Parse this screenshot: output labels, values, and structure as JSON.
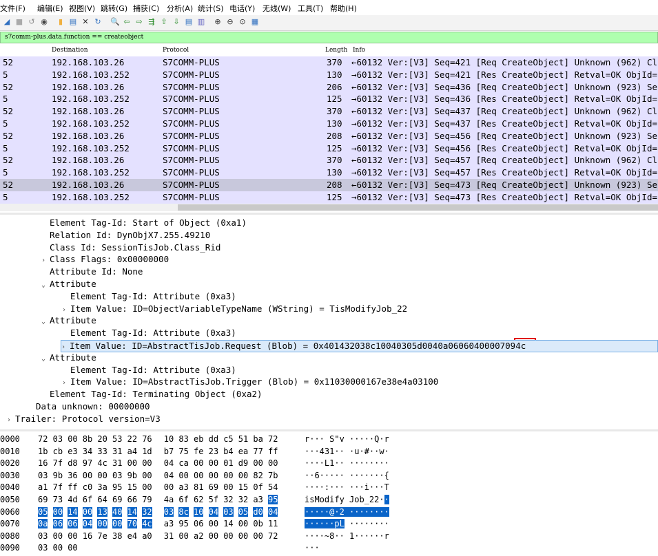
{
  "menu": [
    "文件(F)",
    "编辑(E)",
    "视图(V)",
    "跳转(G)",
    "捕获(C)",
    "分析(A)",
    "统计(S)",
    "电话(Y)",
    "无线(W)",
    "工具(T)",
    "帮助(H)"
  ],
  "toolbar_icons": [
    "shark-fin-icon",
    "stop-icon",
    "restart-icon",
    "options-icon",
    "open-icon",
    "save-icon",
    "close-file-icon",
    "reload-icon",
    "find-icon",
    "back-icon",
    "forward-icon",
    "go-to-packet-icon",
    "go-first-icon",
    "go-last-icon",
    "autoscroll-icon",
    "colorize-icon",
    "zoom-in-icon",
    "zoom-out-icon",
    "zoom-normal-icon",
    "resize-columns-icon"
  ],
  "filter": {
    "text": "s7comm-plus.data.function == createobject"
  },
  "columns": {
    "destination": "Destination",
    "protocol": "Protocol",
    "length": "Length",
    "info": "Info"
  },
  "packets": [
    {
      "src": "52",
      "dst": "192.168.103.26",
      "proto": "S7COMM-PLUS",
      "len": "370",
      "info": "←60132 Ver:[V3] Seq=421 [Req CreateObject] Unknown (962) Cl"
    },
    {
      "src": "5",
      "dst": "192.168.103.252",
      "proto": "S7COMM-PLUS",
      "len": "130",
      "info": "→60132 Ver:[V3] Seq=421 [Res CreateObject] Retval=OK ObjId="
    },
    {
      "src": "52",
      "dst": "192.168.103.26",
      "proto": "S7COMM-PLUS",
      "len": "206",
      "info": "←60132 Ver:[V3] Seq=436 [Req CreateObject] Unknown (923) Se"
    },
    {
      "src": "5",
      "dst": "192.168.103.252",
      "proto": "S7COMM-PLUS",
      "len": "125",
      "info": "→60132 Ver:[V3] Seq=436 [Res CreateObject] Retval=OK ObjId="
    },
    {
      "src": "52",
      "dst": "192.168.103.26",
      "proto": "S7COMM-PLUS",
      "len": "370",
      "info": "←60132 Ver:[V3] Seq=437 [Req CreateObject] Unknown (962) Cl"
    },
    {
      "src": "5",
      "dst": "192.168.103.252",
      "proto": "S7COMM-PLUS",
      "len": "130",
      "info": "→60132 Ver:[V3] Seq=437 [Res CreateObject] Retval=OK ObjId="
    },
    {
      "src": "52",
      "dst": "192.168.103.26",
      "proto": "S7COMM-PLUS",
      "len": "208",
      "info": "←60132 Ver:[V3] Seq=456 [Req CreateObject] Unknown (923) Se"
    },
    {
      "src": "5",
      "dst": "192.168.103.252",
      "proto": "S7COMM-PLUS",
      "len": "125",
      "info": "→60132 Ver:[V3] Seq=456 [Res CreateObject] Retval=OK ObjId="
    },
    {
      "src": "52",
      "dst": "192.168.103.26",
      "proto": "S7COMM-PLUS",
      "len": "370",
      "info": "←60132 Ver:[V3] Seq=457 [Req CreateObject] Unknown (962) Cl"
    },
    {
      "src": "5",
      "dst": "192.168.103.252",
      "proto": "S7COMM-PLUS",
      "len": "130",
      "info": "→60132 Ver:[V3] Seq=457 [Res CreateObject] Retval=OK ObjId="
    },
    {
      "src": "52",
      "dst": "192.168.103.26",
      "proto": "S7COMM-PLUS",
      "len": "208",
      "info": "←60132 Ver:[V3] Seq=473 [Req CreateObject] Unknown (923) Se",
      "selected": true
    },
    {
      "src": "5",
      "dst": "192.168.103.252",
      "proto": "S7COMM-PLUS",
      "len": "125",
      "info": "→60132 Ver:[V3] Seq=473 [Res CreateObject] Retval=OK ObjId="
    }
  ],
  "details": [
    {
      "tri": "",
      "text": "Element Tag-Id: Start of Object (0xa1)",
      "level": 3
    },
    {
      "tri": "",
      "text": "Relation Id: DynObjX7.255.49210",
      "level": 3
    },
    {
      "tri": "",
      "text": "Class Id: SessionTisJob.Class_Rid",
      "level": 3
    },
    {
      "tri": ">",
      "text": "Class Flags: 0x00000000",
      "level": 3
    },
    {
      "tri": "",
      "text": "Attribute Id: None",
      "level": 3
    },
    {
      "tri": "v",
      "text": "Attribute",
      "level": 3
    },
    {
      "tri": "",
      "text": "Element Tag-Id: Attribute (0xa3)",
      "level": 4
    },
    {
      "tri": ">",
      "text": "Item Value: ID=ObjectVariableTypeName (WString) = TisModifyJob_22",
      "level": 4
    },
    {
      "tri": "v",
      "text": "Attribute",
      "level": 3
    },
    {
      "tri": "",
      "text": "Element Tag-Id: Attribute (0xa3)",
      "level": 4
    },
    {
      "tri": ">",
      "text": "Item Value: ID=AbstractTisJob.Request (Blob) = 0x401432038c10040305d0040a06060400007094c",
      "level": 4,
      "highlight": true
    },
    {
      "tri": "v",
      "text": "Attribute",
      "level": 3
    },
    {
      "tri": "",
      "text": "Element Tag-Id: Attribute (0xa3)",
      "level": 4
    },
    {
      "tri": ">",
      "text": "Item Value: ID=AbstractTisJob.Trigger (Blob) = 0x11030000167e38e4a03100",
      "level": 4
    },
    {
      "tri": "",
      "text": "Element Tag-Id: Terminating Object (0xa2)",
      "level": 3
    },
    {
      "tri": "",
      "text": "Data unknown: 00000000",
      "level": 2
    },
    {
      "tri": ">",
      "text": "Trailer: Protocol version=V3",
      "level": 1
    }
  ],
  "hex_rows": [
    {
      "off": "0000",
      "bytes": [
        "72",
        "03",
        "00",
        "8b",
        "20",
        "53",
        "22",
        "76",
        "10",
        "83",
        "eb",
        "dd",
        "c5",
        "51",
        "ba",
        "72"
      ],
      "ascii": "r··· S\"v ·····Q·r"
    },
    {
      "off": "0010",
      "bytes": [
        "1b",
        "cb",
        "e3",
        "34",
        "33",
        "31",
        "a4",
        "1d",
        "b7",
        "75",
        "fe",
        "23",
        "b4",
        "ea",
        "77",
        "ff"
      ],
      "ascii": "···431·· ·u·#··w·"
    },
    {
      "off": "0020",
      "bytes": [
        "16",
        "7f",
        "d8",
        "97",
        "4c",
        "31",
        "00",
        "00",
        "04",
        "ca",
        "00",
        "00",
        "01",
        "d9",
        "00",
        "00"
      ],
      "ascii": "····L1·· ········"
    },
    {
      "off": "0030",
      "bytes": [
        "03",
        "9b",
        "36",
        "00",
        "00",
        "03",
        "9b",
        "00",
        "04",
        "00",
        "00",
        "00",
        "00",
        "00",
        "82",
        "7b"
      ],
      "ascii": "··6····· ·······{"
    },
    {
      "off": "0040",
      "bytes": [
        "a1",
        "7f",
        "ff",
        "c0",
        "3a",
        "95",
        "15",
        "00",
        "00",
        "a3",
        "81",
        "69",
        "00",
        "15",
        "0f",
        "54"
      ],
      "ascii": "····:··· ···i···T"
    },
    {
      "off": "0050",
      "bytes": [
        "69",
        "73",
        "4d",
        "6f",
        "64",
        "69",
        "66",
        "79",
        "4a",
        "6f",
        "62",
        "5f",
        "32",
        "32",
        "a3",
        "95"
      ],
      "ascii": "isModify Job_22··"
    },
    {
      "off": "0060",
      "bytes": [
        "05",
        "00",
        "14",
        "00",
        "13",
        "40",
        "14",
        "32",
        "03",
        "8c",
        "10",
        "04",
        "03",
        "05",
        "d0",
        "04"
      ],
      "ascii": "·····@·2 ········"
    },
    {
      "off": "0070",
      "bytes": [
        "0a",
        "06",
        "06",
        "04",
        "00",
        "00",
        "70",
        "4c",
        "a3",
        "95",
        "06",
        "00",
        "14",
        "00",
        "0b",
        "11"
      ],
      "ascii": "······pL ········"
    },
    {
      "off": "0080",
      "bytes": [
        "03",
        "00",
        "00",
        "16",
        "7e",
        "38",
        "e4",
        "a0",
        "31",
        "00",
        "a2",
        "00",
        "00",
        "00",
        "00",
        "72"
      ],
      "ascii": "····~8·· 1······r"
    },
    {
      "off": "0090",
      "bytes": [
        "03",
        "00",
        "00"
      ],
      "ascii": "···"
    }
  ],
  "colors": {
    "filter_bg": "#afffaf",
    "row_bg": "#e4e1ff",
    "selected_row_bg": "#c8c8dc",
    "byte_selection": "#0a64c8",
    "highlight_border": "#e00000"
  }
}
